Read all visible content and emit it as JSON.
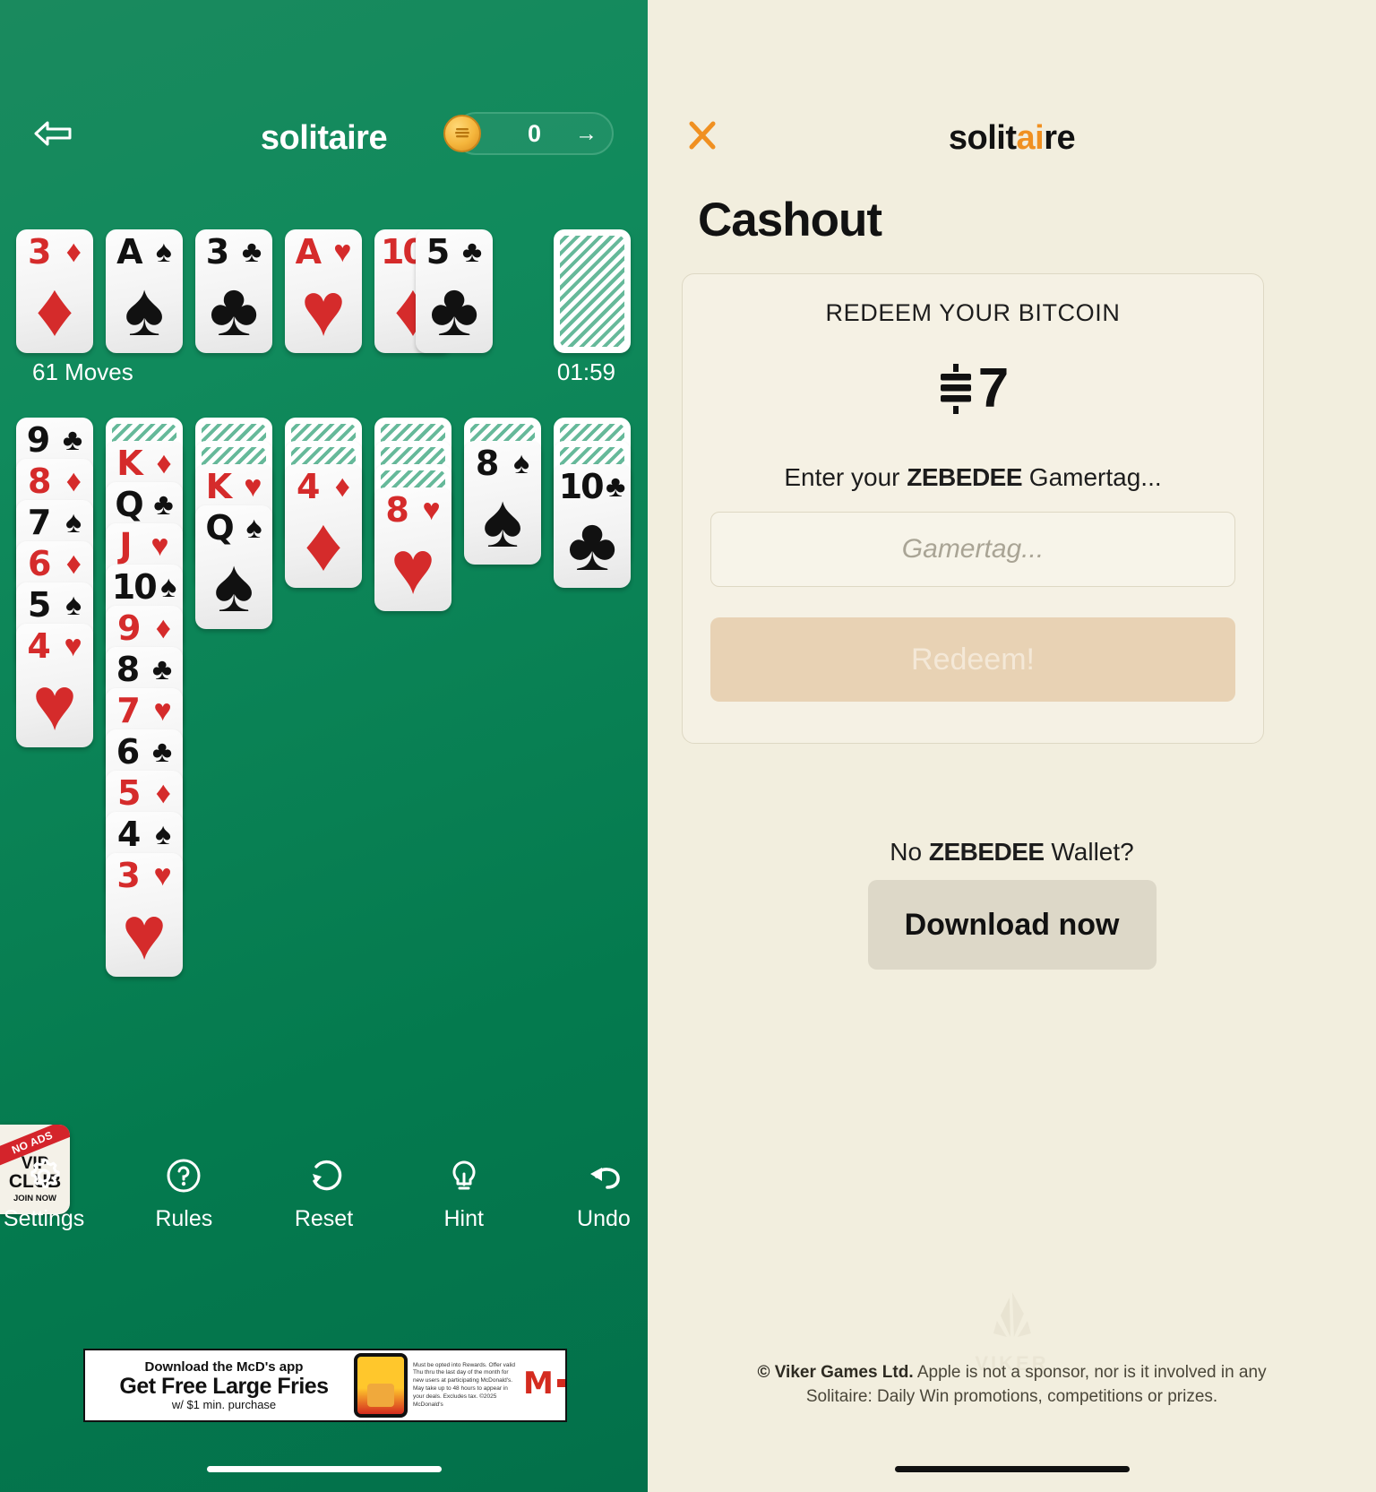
{
  "game": {
    "title": "solitaire",
    "back_icon": "back-arrow-icon",
    "coin_count": "0",
    "coin_arrow": "→",
    "moves": "61 Moves",
    "timer": "01:59",
    "foundation": [
      {
        "rank": "3",
        "suit": "♦",
        "color": "red",
        "facedown": false
      },
      {
        "rank": "A",
        "suit": "♠",
        "color": "black",
        "facedown": false
      },
      {
        "rank": "3",
        "suit": "♣",
        "color": "black",
        "facedown": false
      },
      {
        "rank": "A",
        "suit": "♥",
        "color": "red",
        "facedown": false
      },
      {
        "rank": "10",
        "suit": "♦",
        "color": "red",
        "facedown": false
      },
      {
        "rank": "5",
        "suit": "♣",
        "color": "black",
        "facedown": false
      },
      {
        "rank": "",
        "suit": "",
        "color": "",
        "facedown": true
      }
    ],
    "tableau": [
      {
        "facedown": 0,
        "cards": [
          {
            "rank": "9",
            "suit": "♣",
            "color": "black"
          },
          {
            "rank": "8",
            "suit": "♦",
            "color": "red"
          },
          {
            "rank": "7",
            "suit": "♠",
            "color": "black"
          },
          {
            "rank": "6",
            "suit": "♦",
            "color": "red"
          },
          {
            "rank": "5",
            "suit": "♠",
            "color": "black"
          },
          {
            "rank": "4",
            "suit": "♥",
            "color": "red"
          }
        ]
      },
      {
        "facedown": 1,
        "cards": [
          {
            "rank": "K",
            "suit": "♦",
            "color": "red"
          },
          {
            "rank": "Q",
            "suit": "♣",
            "color": "black"
          },
          {
            "rank": "J",
            "suit": "♥",
            "color": "red"
          },
          {
            "rank": "10",
            "suit": "♠",
            "color": "black"
          },
          {
            "rank": "9",
            "suit": "♦",
            "color": "red"
          },
          {
            "rank": "8",
            "suit": "♣",
            "color": "black"
          },
          {
            "rank": "7",
            "suit": "♥",
            "color": "red"
          },
          {
            "rank": "6",
            "suit": "♣",
            "color": "black"
          },
          {
            "rank": "5",
            "suit": "♦",
            "color": "red"
          },
          {
            "rank": "4",
            "suit": "♠",
            "color": "black"
          },
          {
            "rank": "3",
            "suit": "♥",
            "color": "red"
          }
        ]
      },
      {
        "facedown": 2,
        "cards": [
          {
            "rank": "K",
            "suit": "♥",
            "color": "red"
          },
          {
            "rank": "Q",
            "suit": "♠",
            "color": "black"
          }
        ]
      },
      {
        "facedown": 2,
        "cards": [
          {
            "rank": "4",
            "suit": "♦",
            "color": "red"
          }
        ]
      },
      {
        "facedown": 3,
        "cards": [
          {
            "rank": "8",
            "suit": "♥",
            "color": "red"
          }
        ]
      },
      {
        "facedown": 1,
        "cards": [
          {
            "rank": "8",
            "suit": "♠",
            "color": "black"
          }
        ]
      },
      {
        "facedown": 2,
        "cards": [
          {
            "rank": "10",
            "suit": "♣",
            "color": "black"
          }
        ]
      }
    ],
    "toolbar": [
      {
        "label": "Settings",
        "icon": "gear-icon"
      },
      {
        "label": "Rules",
        "icon": "question-circle-icon"
      },
      {
        "label": "Reset",
        "icon": "reset-circular-arrow-icon"
      },
      {
        "label": "Hint",
        "icon": "lightbulb-icon"
      },
      {
        "label": "Undo",
        "icon": "undo-arrow-icon"
      }
    ],
    "vip_badge": {
      "ribbon": "NO ADS",
      "line1": "VIP",
      "line2": "CLUB",
      "line3": "JOIN NOW"
    },
    "ad": {
      "headline": "Download the McD's app",
      "main": "Get Free Large Fries",
      "sub": "w/ $1 min. purchase",
      "legal": "Must be opted into Rewards. Offer valid Thu thru the last day of the month for new users at participating McDonald's. May take up to 48 hours to appear in your deals. Excludes tax. ©2025 McDonald's",
      "brand_mark": "M"
    }
  },
  "cashout": {
    "close_icon": "close-x-icon",
    "logo_part1": "solit",
    "logo_accent": "ai",
    "logo_part2": "re",
    "heading": "Cashout",
    "redeem_label": "REDEEM YOUR BITCOIN",
    "amount": "7",
    "sat_icon": "satoshi-symbol-icon",
    "enter_prefix": "Enter your ",
    "enter_brand": "ZEBEDEE",
    "enter_suffix": " Gamertag...",
    "input_placeholder": "Gamertag...",
    "input_value": "",
    "redeem_button": "Redeem!",
    "no_wallet_prefix": "No ",
    "no_wallet_brand": "ZEBEDEE",
    "no_wallet_suffix": " Wallet?",
    "download_button": "Download now",
    "watermark": "VIKER",
    "footer_bold": "© Viker Games Ltd.",
    "footer_line1": " Apple is not a sponsor, nor is it involved in any",
    "footer_line2": "Solitaire: Daily Win promotions, competitions or prizes."
  },
  "colors": {
    "table_green": "#0a7d52",
    "cream": "#f2eede",
    "accent_orange": "#f09021",
    "card_red": "#d52b2b",
    "card_black": "#111111",
    "redeem_disabled": "#e8d2b4"
  }
}
